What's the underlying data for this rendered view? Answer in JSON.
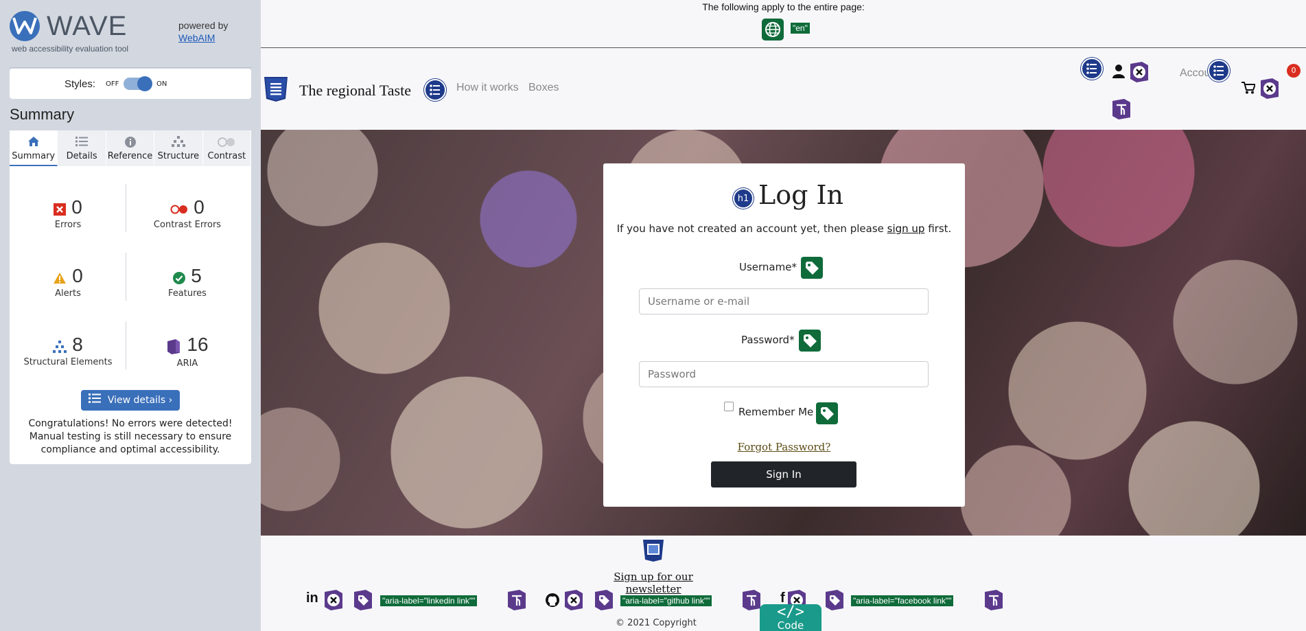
{
  "wave": {
    "logo_text": "WAVE",
    "tagline": "web accessibility evaluation tool",
    "powered_by": "powered by",
    "webaim_link": "WebAIM",
    "styles_label": "Styles:",
    "styles_off": "OFF",
    "styles_on": "ON",
    "summary_title": "Summary",
    "tabs": [
      {
        "label": "Summary",
        "icon": "home-icon"
      },
      {
        "label": "Details",
        "icon": "list-icon"
      },
      {
        "label": "Reference",
        "icon": "info-icon"
      },
      {
        "label": "Structure",
        "icon": "hierarchy-icon"
      },
      {
        "label": "Contrast",
        "icon": "contrast-icon"
      }
    ],
    "stats": {
      "errors": {
        "count": "0",
        "label": "Errors"
      },
      "contrast_errors": {
        "count": "0",
        "label": "Contrast Errors"
      },
      "alerts": {
        "count": "0",
        "label": "Alerts"
      },
      "features": {
        "count": "5",
        "label": "Features"
      },
      "structural": {
        "count": "8",
        "label": "Structural Elements"
      },
      "aria": {
        "count": "16",
        "label": "ARIA"
      }
    },
    "view_details": "View details ›",
    "congrats": "Congratulations! No errors were detected! Manual testing is still necessary to ensure compliance and optimal accessibility."
  },
  "page": {
    "applies_text": "The following apply to the entire page:",
    "lang_tag": "\"en\"",
    "brand": "The regional Taste",
    "nav": [
      "How it works",
      "Boxes"
    ],
    "account": "Account",
    "cart_count": "0",
    "login": {
      "title": "Log In",
      "sub_before": "If you have not created an account yet, then please ",
      "sub_link": "sign up",
      "sub_after": " first.",
      "username_label": "Username*",
      "username_placeholder": "Username or e-mail",
      "password_label": "Password*",
      "password_placeholder": "Password",
      "remember": "Remember Me",
      "forgot": "Forgot Password?",
      "signin": "Sign In"
    },
    "footer": {
      "newsletter": "Sign up for our newsletter",
      "linkedin_label": "\"aria-label=\"linkedin link\"\"",
      "github_label": "\"aria-label=\"github link\"\"",
      "facebook_label": "\"aria-label=\"facebook link\"\"",
      "copyright": "© 2021 Copyright",
      "code_glyph": "</>",
      "code_label": "Code"
    }
  },
  "colors": {
    "wave_blue": "#3a6fba",
    "feature_green": "#0f6b3a",
    "aria_purple": "#5b3a8c",
    "structure_navy": "#1e3a8a",
    "error_red": "#d92d20"
  }
}
